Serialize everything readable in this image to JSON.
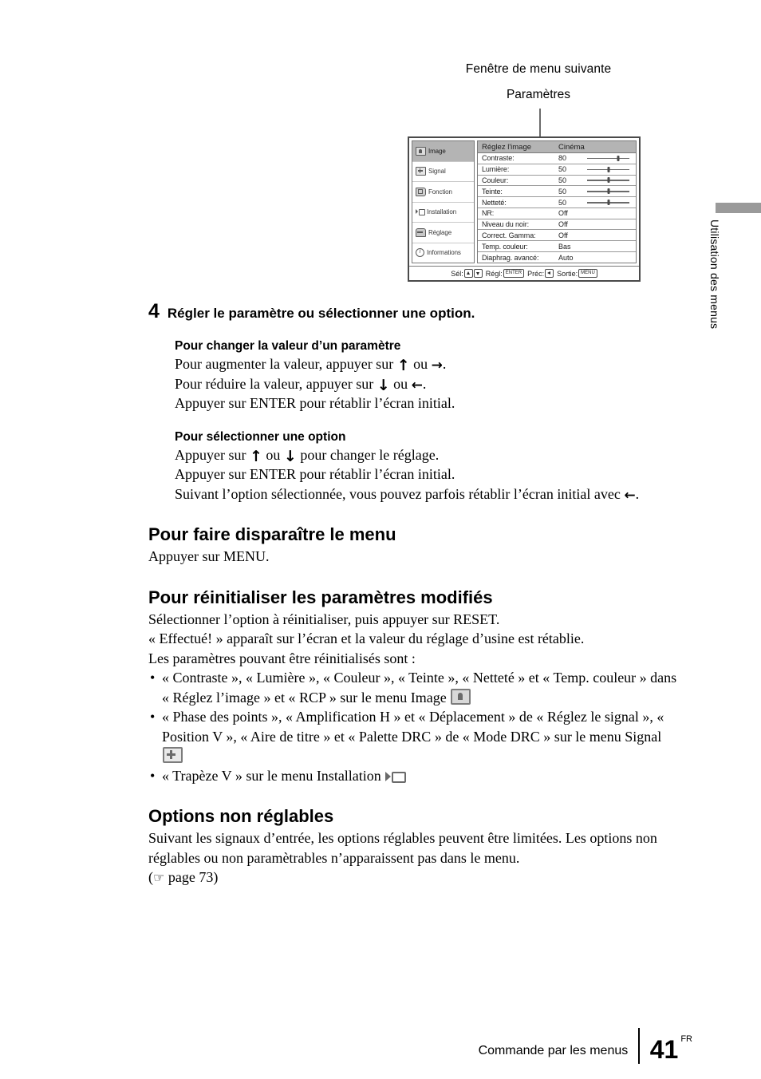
{
  "figure": {
    "caption_top": "Fenêtre de menu suivante",
    "caption_second": "Paramètres"
  },
  "osd": {
    "sidebar": [
      {
        "label": "Image",
        "icon": "image-icon",
        "selected": true
      },
      {
        "label": "Signal",
        "icon": "signal-icon",
        "selected": false
      },
      {
        "label": "Fonction",
        "icon": "function-icon",
        "selected": false
      },
      {
        "label": "Installation",
        "icon": "installation-icon",
        "selected": false
      },
      {
        "label": "Réglage",
        "icon": "setup-icon",
        "selected": false
      },
      {
        "label": "Informations",
        "icon": "information-icon",
        "selected": false
      }
    ],
    "title": {
      "label": "Réglez l'image",
      "value": "Cinéma"
    },
    "rows": [
      {
        "label": "Contraste:",
        "value": "80",
        "slider": true,
        "pos": 72
      },
      {
        "label": "Lumière:",
        "value": "50",
        "slider": true,
        "pos": 50
      },
      {
        "label": "Couleur:",
        "value": "50",
        "slider": true,
        "pos": 50
      },
      {
        "label": "Teinte:",
        "value": "50",
        "slider": true,
        "pos": 50
      },
      {
        "label": "Netteté:",
        "value": "50",
        "slider": true,
        "pos": 50
      },
      {
        "label": "NR:",
        "value": "Off",
        "slider": false
      },
      {
        "label": "Niveau du noir:",
        "value": "Off",
        "slider": false
      },
      {
        "label": "Correct. Gamma:",
        "value": "Off",
        "slider": false
      },
      {
        "label": "Temp. couleur:",
        "value": "Bas",
        "slider": false
      },
      {
        "label": "Diaphrag. avancé:",
        "value": "Auto",
        "slider": false
      }
    ],
    "footer": {
      "sel_label": "Sél:",
      "regl_label": "Régl:",
      "regl_key": "ENTER",
      "prec_label": "Préc:",
      "sortie_label": "Sortie:",
      "sortie_key": "MENU"
    }
  },
  "side_tab": {
    "label": "Utilisation des menus"
  },
  "content": {
    "step_number": "4",
    "step_title": "Régler le paramètre ou sélectionner une option.",
    "sub1": {
      "heading": "Pour changer la valeur d’un paramètre",
      "line1_a": "Pour augmenter la valeur, appuyer sur ",
      "line1_b": " ou ",
      "line1_c": ".",
      "line2_a": "Pour réduire la valeur, appuyer sur ",
      "line2_b": " ou ",
      "line2_c": ".",
      "line3": "Appuyer sur ENTER pour rétablir l’écran initial."
    },
    "sub2": {
      "heading": "Pour sélectionner une option",
      "line1_a": "Appuyer sur ",
      "line1_b": " ou ",
      "line1_c": " pour changer le réglage.",
      "line2": "Appuyer sur ENTER pour rétablir l’écran initial.",
      "line3_a": "Suivant l’option sélectionnée, vous pouvez parfois rétablir l’écran initial avec ",
      "line3_b": "."
    },
    "sec1": {
      "heading": "Pour faire disparaître le menu",
      "body": "Appuyer sur MENU."
    },
    "sec2": {
      "heading": "Pour réinitialiser les paramètres modifiés",
      "line1": "Sélectionner l’option à réinitialiser, puis appuyer sur RESET.",
      "line2": "« Effectué! » apparaît sur l’écran et la valeur du réglage d’usine est rétablie.",
      "line3": "Les paramètres pouvant être réinitialisés sont :",
      "bullet1_a": "« Contraste », « Lumière », « Couleur », « Teinte », « Netteté » et « Temp. couleur » dans « Réglez l’image » et « RCP » sur le menu Image ",
      "bullet2_a": "« Phase des points », « Amplification H » et « Déplacement » de « Réglez le signal », « Position V », « Aire de titre » et « Palette DRC » de « Mode DRC » sur le menu Signal ",
      "bullet3_a": "« Trapèze V » sur le menu Installation "
    },
    "sec3": {
      "heading": "Options non réglables",
      "line1": "Suivant les signaux d’entrée, les options réglables peuvent être limitées. Les options non réglables ou non paramètrables n’apparaissent pas dans le menu.",
      "line2_prefix": "(",
      "line2_text": " page 73)"
    }
  },
  "page_footer": {
    "title": "Commande par les menus",
    "page_number": "41",
    "language": "FR"
  },
  "glyphs": {
    "arrow_up": "↑",
    "arrow_down": "↓",
    "arrow_left": "←",
    "arrow_right": "→",
    "hand": "☞"
  }
}
